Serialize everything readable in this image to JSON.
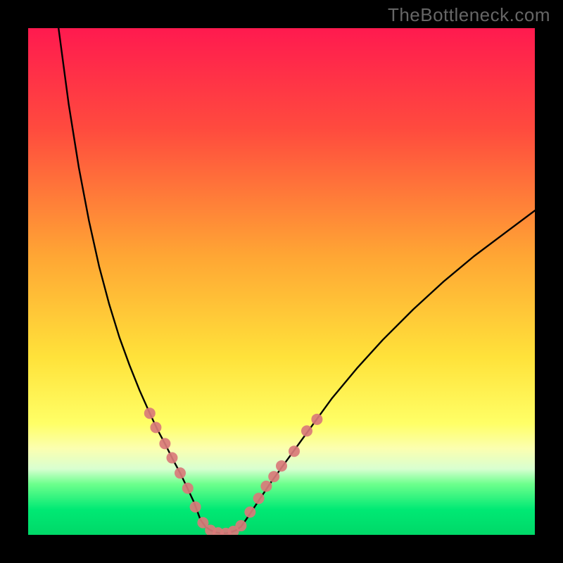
{
  "watermark": {
    "text": "TheBottleneck.com"
  },
  "chart_data": {
    "type": "line",
    "title": "",
    "xlabel": "",
    "ylabel": "",
    "xlim": [
      0,
      100
    ],
    "ylim": [
      0,
      100
    ],
    "gradient_stops": [
      {
        "offset": 0,
        "color": "#ff1a4f"
      },
      {
        "offset": 20,
        "color": "#ff4b3e"
      },
      {
        "offset": 45,
        "color": "#ffa634"
      },
      {
        "offset": 65,
        "color": "#ffe23a"
      },
      {
        "offset": 78,
        "color": "#ffff66"
      },
      {
        "offset": 83,
        "color": "#fbffb0"
      },
      {
        "offset": 87,
        "color": "#d8ffd0"
      },
      {
        "offset": 90,
        "color": "#6cff8c"
      },
      {
        "offset": 95,
        "color": "#00e974"
      },
      {
        "offset": 100,
        "color": "#00d868"
      }
    ],
    "series": [
      {
        "name": "left-arm",
        "x": [
          6,
          8,
          10,
          12,
          14,
          16,
          18,
          20,
          22,
          24,
          25.5,
          27,
          28.5,
          30,
          31.3,
          32.7,
          34
        ],
        "values": [
          100,
          85,
          72.5,
          62,
          53,
          45.5,
          39,
          33.5,
          28.5,
          24,
          20.8,
          18,
          15,
          12.2,
          9.5,
          6.5,
          3
        ]
      },
      {
        "name": "valley",
        "x": [
          34,
          35,
          36,
          37,
          38,
          39,
          40,
          41,
          42,
          43
        ],
        "values": [
          3,
          1.6,
          0.9,
          0.5,
          0.3,
          0.3,
          0.5,
          0.9,
          1.6,
          3
        ]
      },
      {
        "name": "right-arm",
        "x": [
          43,
          45,
          48,
          52,
          56,
          60,
          65,
          70,
          76,
          82,
          88,
          94,
          100
        ],
        "values": [
          3,
          6,
          10.5,
          16,
          21.5,
          27,
          33,
          38.5,
          44.5,
          50,
          55,
          59.5,
          64
        ]
      }
    ],
    "markers": {
      "name": "highlight-dots",
      "color": "#d97a7a",
      "points": [
        {
          "x": 24.0,
          "y": 24.0
        },
        {
          "x": 25.2,
          "y": 21.2
        },
        {
          "x": 27.0,
          "y": 18.0
        },
        {
          "x": 28.4,
          "y": 15.2
        },
        {
          "x": 30.0,
          "y": 12.2
        },
        {
          "x": 31.5,
          "y": 9.2
        },
        {
          "x": 33.0,
          "y": 5.5
        },
        {
          "x": 34.5,
          "y": 2.4
        },
        {
          "x": 36.0,
          "y": 0.9
        },
        {
          "x": 37.5,
          "y": 0.4
        },
        {
          "x": 39.0,
          "y": 0.3
        },
        {
          "x": 40.5,
          "y": 0.7
        },
        {
          "x": 42.0,
          "y": 1.8
        },
        {
          "x": 43.8,
          "y": 4.5
        },
        {
          "x": 45.5,
          "y": 7.2
        },
        {
          "x": 47.0,
          "y": 9.6
        },
        {
          "x": 48.5,
          "y": 11.5
        },
        {
          "x": 50.0,
          "y": 13.6
        },
        {
          "x": 52.5,
          "y": 16.5
        },
        {
          "x": 55.0,
          "y": 20.5
        },
        {
          "x": 57.0,
          "y": 22.8
        }
      ]
    }
  }
}
